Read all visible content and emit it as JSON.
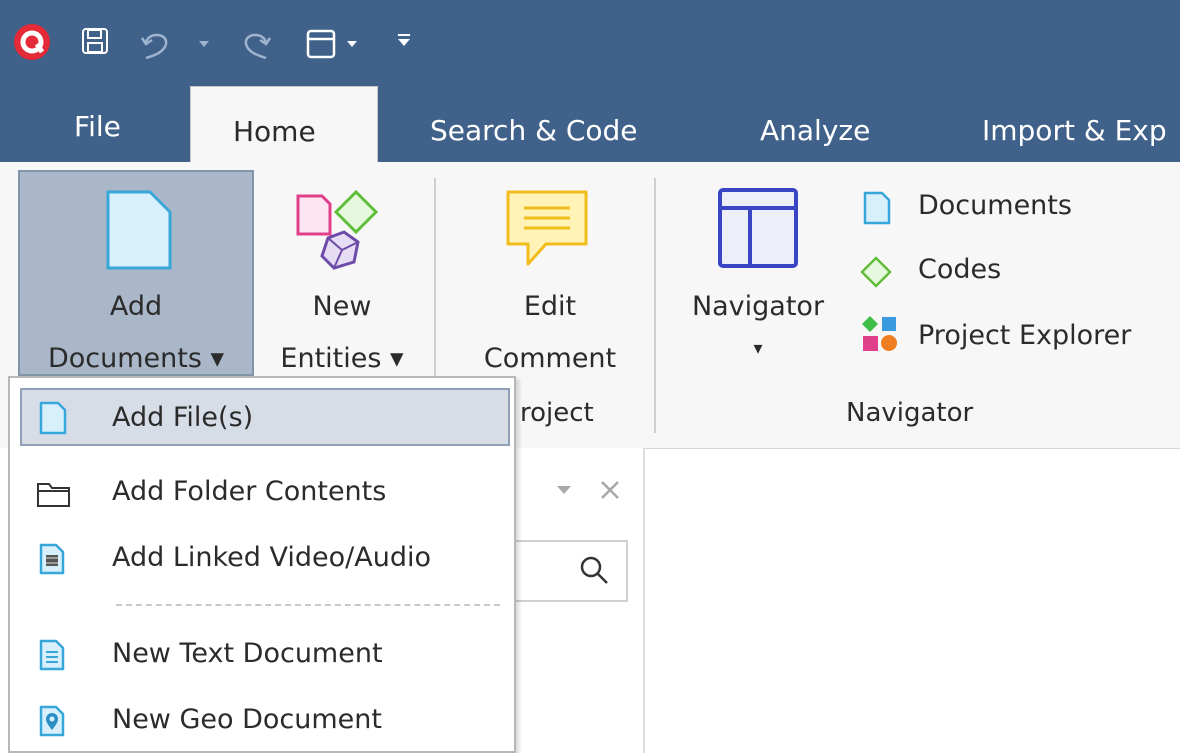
{
  "titlebar": {
    "logo": "atlas-logo-icon",
    "quick_access": [
      "save-icon",
      "undo-icon",
      "dropdown-arrow-icon",
      "redo-icon",
      "window-layout-icon",
      "customize-qat-icon"
    ]
  },
  "tabs": [
    {
      "label": "File"
    },
    {
      "label": "Home"
    },
    {
      "label": "Search & Code"
    },
    {
      "label": "Analyze"
    },
    {
      "label": "Import & Exp"
    }
  ],
  "ribbon": {
    "add_documents": {
      "line1": "Add",
      "line2": "Documents ▾"
    },
    "new_entities": {
      "line1": "New",
      "line2": "Entities ▾"
    },
    "edit_comment": {
      "line1": "Edit",
      "line2": "Comment"
    },
    "project_group_label": "roject",
    "navigator_button": {
      "line1": "Navigator",
      "arrow": "▾"
    },
    "navigator_items": [
      "Documents",
      "Codes",
      "Project Explorer"
    ],
    "navigator_group_label": "Navigator"
  },
  "menu": {
    "items": [
      {
        "label": "Add File(s)",
        "icon": "document-icon",
        "selected": true
      },
      {
        "label": "Add Folder Contents",
        "icon": "folder-icon"
      },
      {
        "label": "Add Linked Video/Audio",
        "icon": "video-document-icon"
      },
      {
        "label": "New Text Document",
        "icon": "text-document-icon"
      },
      {
        "label": "New Geo Document",
        "icon": "geo-document-icon"
      }
    ]
  },
  "pane": {
    "controls": [
      "dropdown-arrow-icon",
      "close-icon"
    ],
    "search_icon": "search-icon"
  },
  "colors": {
    "titlebar": "#40618a",
    "ribbon": "#f7f7f7",
    "menu_highlight": "#d7dde6",
    "doc_icon_fill": "#d8f0fb",
    "doc_icon_stroke": "#37a6d9"
  }
}
